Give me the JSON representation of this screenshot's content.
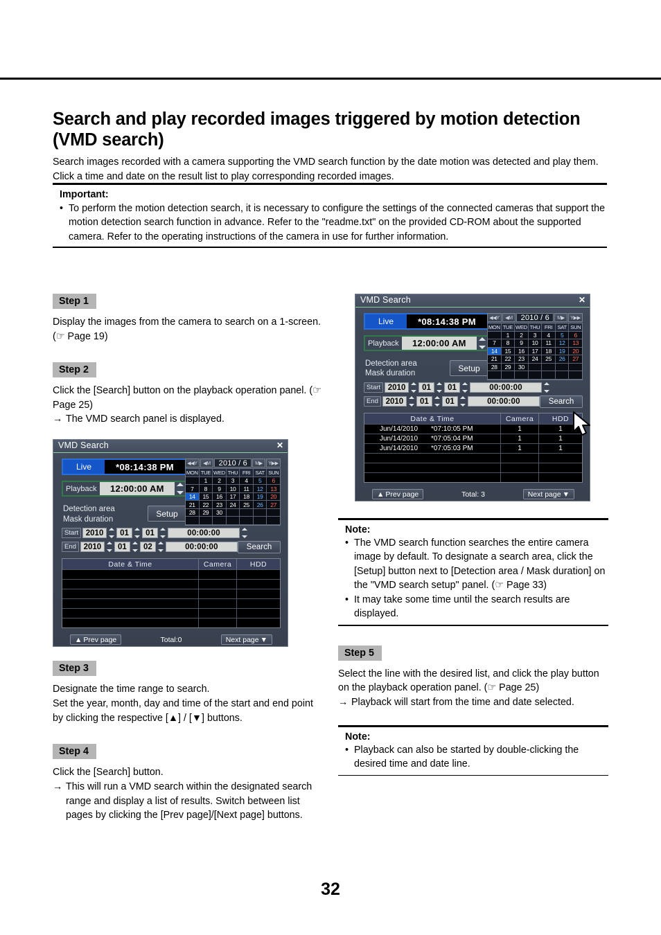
{
  "document": {
    "title": "Search and play recorded images triggered by motion detection (VMD search)",
    "intro": "Search images recorded with a camera supporting the VMD search function by the date motion was detected and play them. Click a time and date on the result list to play corresponding recorded images.",
    "page_number": "32"
  },
  "important": {
    "heading": "Important:",
    "bullet_glyph": "•",
    "items": [
      "To perform the motion detection search, it is necessary to configure the settings of the connected cameras that support the motion detection search function in advance. Refer to the \"readme.txt\" on the provided CD-ROM about the supported camera. Refer to the operating instructions of the camera in use for further information."
    ]
  },
  "steps": {
    "step1": {
      "badge": "Step 1",
      "text": "Display the images from the camera to search on a 1-screen. (☞ Page 19)"
    },
    "step2": {
      "badge": "Step 2",
      "text": "Click the [Search] button on the playback operation panel. (☞ Page 25)",
      "arrow_glyph": "→",
      "arrow_text": "The VMD search panel is displayed."
    },
    "step3": {
      "badge": "Step 3",
      "line1": "Designate the time range to search.",
      "line2": "Set the year, month, day and time of the start and end point by clicking the respective [▲] / [▼] buttons."
    },
    "step4": {
      "badge": "Step 4",
      "text": "Click the [Search] button.",
      "arrow_glyph": "→",
      "arrow_text": "This will run a VMD search within the designated search range and display a list of results. Switch between list pages by clicking the [Prev page]/[Next page] buttons."
    },
    "step5": {
      "badge": "Step 5",
      "text": "Select the line with the desired list, and click the play button on the playback operation panel. (☞ Page 25)",
      "arrow_glyph": "→",
      "arrow_text": "Playback will start from the time and date selected."
    }
  },
  "note_right": {
    "heading": "Note:",
    "bullet_glyph": "•",
    "items": [
      "The VMD search function searches the entire camera image by default. To designate a search area, click the [Setup] button next to [Detection area / Mask duration] on the \"VMD search setup\" panel. (☞ Page 33)",
      "It may take some time until the search results are displayed."
    ]
  },
  "note_bottom": {
    "heading": "Note:",
    "bullet_glyph": "•",
    "items": [
      "Playback can also be started by double-clicking the desired time and date line."
    ]
  },
  "vmd_panel_left": {
    "window_title": "VMD Search",
    "close_glyph": "✕",
    "live_label": "Live",
    "live_time": "*08:14:38 PM",
    "playback_label": "Playback",
    "playback_time": "12:00:00 AM",
    "detection_line1": "Detection area",
    "detection_line2": "Mask duration",
    "setup_label": "Setup",
    "calendar": {
      "prev_year": "◀◀Y",
      "prev_month": "◀M",
      "year_month": "2010 /  6",
      "next_month": "M▶",
      "next_year": "Y▶▶",
      "weekdays": [
        "MON",
        "TUE",
        "WED",
        "THU",
        "FRI",
        "SAT",
        "SUN"
      ],
      "weeks": [
        [
          "",
          "1",
          "2",
          "3",
          "4",
          "5",
          "6"
        ],
        [
          "7",
          "8",
          "9",
          "10",
          "11",
          "12",
          "13"
        ],
        [
          "14",
          "15",
          "16",
          "17",
          "18",
          "19",
          "20"
        ],
        [
          "21",
          "22",
          "23",
          "24",
          "25",
          "26",
          "27"
        ],
        [
          "28",
          "29",
          "30",
          "",
          "",
          "",
          ""
        ],
        [
          "",
          "",
          "",
          "",
          "",
          "",
          ""
        ]
      ],
      "selected_day": "14"
    },
    "start": {
      "tag": "Start",
      "year": "2010",
      "month": "01",
      "day": "01",
      "time": "00:00:00"
    },
    "end": {
      "tag": "End",
      "year": "2010",
      "month": "01",
      "day": "02",
      "time": "00:00:00"
    },
    "search_label": "Search",
    "results": {
      "columns": [
        "Date & Time",
        "Camera",
        "HDD"
      ],
      "rows": [],
      "empty_row_count": 6
    },
    "prev_page_label": "Prev page",
    "prev_page_glyph": "▲",
    "total_label": "Total:0",
    "next_page_label": "Next page",
    "next_page_glyph": "▼"
  },
  "vmd_panel_right": {
    "window_title": "VMD Search",
    "close_glyph": "✕",
    "live_label": "Live",
    "live_time": "*08:14:38 PM",
    "playback_label": "Playback",
    "playback_time": "12:00:00 AM",
    "detection_line1": "Detection area",
    "detection_line2": "Mask duration",
    "setup_label": "Setup",
    "calendar": {
      "prev_year": "◀◀Y",
      "prev_month": "◀M",
      "year_month": "2010 /  6",
      "next_month": "M▶",
      "next_year": "Y▶▶",
      "weekdays": [
        "MON",
        "TUE",
        "WED",
        "THU",
        "FRI",
        "SAT",
        "SUN"
      ],
      "weeks": [
        [
          "",
          "1",
          "2",
          "3",
          "4",
          "5",
          "6"
        ],
        [
          "7",
          "8",
          "9",
          "10",
          "11",
          "12",
          "13"
        ],
        [
          "14",
          "15",
          "16",
          "17",
          "18",
          "19",
          "20"
        ],
        [
          "21",
          "22",
          "23",
          "24",
          "25",
          "26",
          "27"
        ],
        [
          "28",
          "29",
          "30",
          "",
          "",
          "",
          ""
        ],
        [
          "",
          "",
          "",
          "",
          "",
          "",
          ""
        ]
      ],
      "selected_day": "14"
    },
    "start": {
      "tag": "Start",
      "year": "2010",
      "month": "01",
      "day": "01",
      "time": "00:00:00"
    },
    "end": {
      "tag": "End",
      "year": "2010",
      "month": "01",
      "day": "01",
      "time": "00:00:00"
    },
    "search_label": "Search",
    "results": {
      "columns": [
        "Date & Time",
        "Camera",
        "HDD"
      ],
      "rows": [
        {
          "date": "Jun/14/2010",
          "time": "*07:10:05 PM",
          "camera": "1",
          "hdd": "1"
        },
        {
          "date": "Jun/14/2010",
          "time": "*07:05:04 PM",
          "camera": "1",
          "hdd": "1"
        },
        {
          "date": "Jun/14/2010",
          "time": "*07:05:03 PM",
          "camera": "1",
          "hdd": "1"
        }
      ],
      "empty_row_count": 3
    },
    "prev_page_label": "Prev page",
    "prev_page_glyph": "▲",
    "total_label": "Total: 3",
    "next_page_label": "Next page",
    "next_page_glyph": "▼"
  },
  "colors": {
    "accent_live": "#1456c8",
    "accent_playback_border": "#2f7a48",
    "panel_bg": "#3e4756",
    "list_header": "#38405c",
    "selected_day": "#1660c8",
    "saturday": "#6fb8ff",
    "sunday": "#ff6d5a",
    "step_badge_bg": "#b5b5b5"
  }
}
